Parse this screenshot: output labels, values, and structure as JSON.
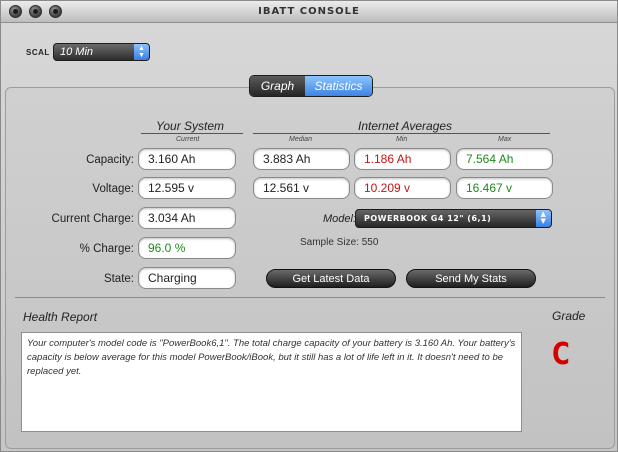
{
  "window": {
    "title": "IBATT CONSOLE"
  },
  "scal": {
    "label": "SCAL",
    "value": "10 Min"
  },
  "tabs": [
    {
      "label": "Graph"
    },
    {
      "label": "Statistics"
    }
  ],
  "headers": {
    "your_system": "Your System",
    "current": "Current",
    "internet_averages": "Internet Averages",
    "median": "Median",
    "min": "Min",
    "max": "Max"
  },
  "rows": {
    "capacity": {
      "label": "Capacity:",
      "current": "3.160 Ah",
      "median": "3.883 Ah",
      "min": "1.186 Ah",
      "max": "7.564 Ah"
    },
    "voltage": {
      "label": "Voltage:",
      "current": "12.595 v",
      "median": "12.561 v",
      "min": "10.209 v",
      "max": "16.467 v"
    },
    "current_charge": {
      "label": "Current Charge:",
      "current": "3.034 Ah"
    },
    "percent_charge": {
      "label": "% Charge:",
      "current": "96.0 %"
    },
    "state": {
      "label": "State:",
      "current": "Charging"
    }
  },
  "model": {
    "label": "Model:",
    "value": "POWERBOOK G4 12\" (6,1)"
  },
  "sample_size": "Sample Size: 550",
  "buttons": {
    "get_latest": "Get Latest Data",
    "send_stats": "Send My Stats"
  },
  "health": {
    "title": "Health Report",
    "text": "Your computer's model code is \"PowerBook6,1\". The total charge capacity of your battery is 3.160 Ah. Your battery's capacity is below average for this model PowerBook/iBook, but it still has a lot of life left in it. It doesn't need to be replaced yet."
  },
  "grade": {
    "title": "Grade",
    "value": "C"
  },
  "colors": {
    "low": "#c81414",
    "high": "#1f8a1f",
    "accent": "#3d84e3"
  }
}
